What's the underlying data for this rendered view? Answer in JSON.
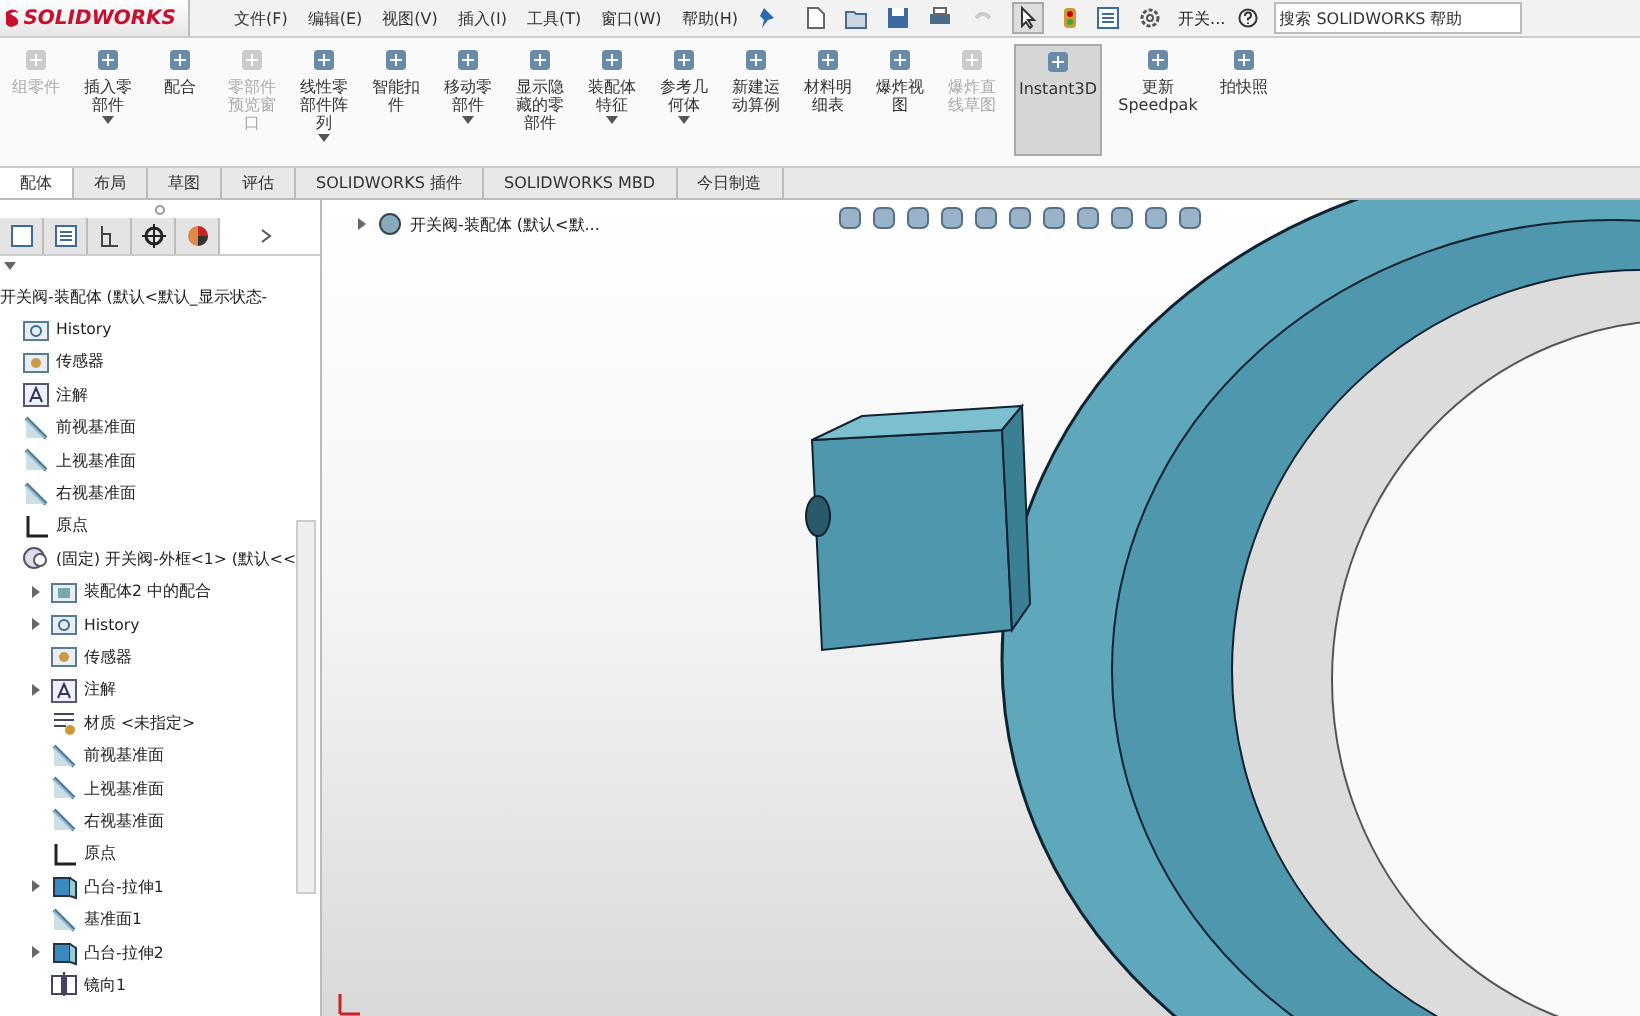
{
  "titlebar": {
    "logo": "SOLIDWORKS",
    "menu": [
      "文件(F)",
      "编辑(E)",
      "视图(V)",
      "插入(I)",
      "工具(T)",
      "窗口(W)",
      "帮助(H)"
    ],
    "document": "开关...",
    "search": {
      "placeholder": "搜索 SOLIDWORKS 帮助"
    }
  },
  "ribbon": [
    {
      "label": "组零件",
      "disabled": true,
      "dropdown": false,
      "selected": false
    },
    {
      "label": "插入零部件",
      "disabled": false,
      "dropdown": true,
      "selected": false
    },
    {
      "label": "配合",
      "disabled": false,
      "dropdown": false,
      "selected": false
    },
    {
      "label": "零部件预览窗口",
      "disabled": true,
      "dropdown": false,
      "selected": false
    },
    {
      "label": "线性零部件阵列",
      "disabled": false,
      "dropdown": true,
      "selected": false
    },
    {
      "label": "智能扣件",
      "disabled": false,
      "dropdown": false,
      "selected": false
    },
    {
      "label": "移动零部件",
      "disabled": false,
      "dropdown": true,
      "selected": false
    },
    {
      "label": "显示隐藏的零部件",
      "disabled": false,
      "dropdown": false,
      "selected": false
    },
    {
      "label": "装配体特征",
      "disabled": false,
      "dropdown": true,
      "selected": false
    },
    {
      "label": "参考几何体",
      "disabled": false,
      "dropdown": true,
      "selected": false
    },
    {
      "label": "新建运动算例",
      "disabled": false,
      "dropdown": false,
      "selected": false
    },
    {
      "label": "材料明细表",
      "disabled": false,
      "dropdown": false,
      "selected": false
    },
    {
      "label": "爆炸视图",
      "disabled": false,
      "dropdown": false,
      "selected": false
    },
    {
      "label": "爆炸直线草图",
      "disabled": true,
      "dropdown": false,
      "selected": false
    },
    {
      "label": "Instant3D",
      "disabled": false,
      "dropdown": false,
      "selected": true
    },
    {
      "label": "更新 Speedpak",
      "disabled": false,
      "dropdown": false,
      "selected": false
    },
    {
      "label": "拍快照",
      "disabled": false,
      "dropdown": false,
      "selected": false
    }
  ],
  "tabs": [
    {
      "label": "配体",
      "selected": true
    },
    {
      "label": "布局",
      "selected": false
    },
    {
      "label": "草图",
      "selected": false
    },
    {
      "label": "评估",
      "selected": false
    },
    {
      "label": "SOLIDWORKS 插件",
      "selected": false
    },
    {
      "label": "SOLIDWORKS MBD",
      "selected": false
    },
    {
      "label": "今日制造",
      "selected": false
    }
  ],
  "tree": {
    "root": "开关阀-装配体  (默认<默认_显示状态-",
    "items": [
      {
        "kind": "history",
        "label": "History",
        "collapsed": false
      },
      {
        "kind": "sensor",
        "label": "传感器",
        "collapsed": false
      },
      {
        "kind": "note",
        "label": "注解",
        "collapsed": false
      },
      {
        "kind": "plane",
        "label": "前视基准面",
        "collapsed": false
      },
      {
        "kind": "plane",
        "label": "上视基准面",
        "collapsed": false
      },
      {
        "kind": "plane",
        "label": "右视基准面",
        "collapsed": false
      },
      {
        "kind": "origin",
        "label": "原点",
        "collapsed": false
      },
      {
        "kind": "part",
        "label": "(固定) 开关阀-外框<1> (默认<<",
        "collapsed": false,
        "children": [
          {
            "kind": "folder",
            "label": "装配体2 中的配合",
            "collapsed": true
          },
          {
            "kind": "history",
            "label": "History",
            "collapsed": true
          },
          {
            "kind": "sensor",
            "label": "传感器",
            "collapsed": false
          },
          {
            "kind": "note",
            "label": "注解",
            "collapsed": true
          },
          {
            "kind": "material",
            "label": "材质 <未指定>",
            "collapsed": false
          },
          {
            "kind": "plane",
            "label": "前视基准面",
            "collapsed": false
          },
          {
            "kind": "plane",
            "label": "上视基准面",
            "collapsed": false
          },
          {
            "kind": "plane",
            "label": "右视基准面",
            "collapsed": false
          },
          {
            "kind": "origin",
            "label": "原点",
            "collapsed": false
          },
          {
            "kind": "extrude",
            "label": "凸台-拉伸1",
            "collapsed": true
          },
          {
            "kind": "plane",
            "label": "基准面1",
            "collapsed": false
          },
          {
            "kind": "extrude",
            "label": "凸台-拉伸2",
            "collapsed": true
          },
          {
            "kind": "mirror",
            "label": "镜向1",
            "collapsed": false
          }
        ]
      }
    ]
  },
  "viewport": {
    "breadcrumb": "开关阀-装配体  (默认<默..."
  }
}
